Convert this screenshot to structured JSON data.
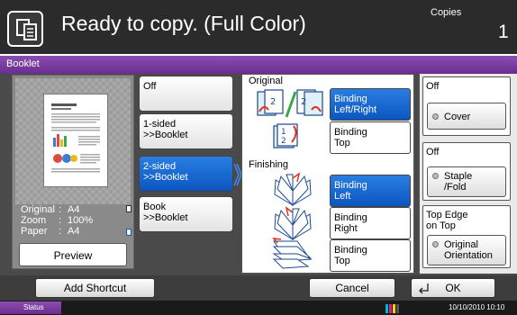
{
  "header": {
    "title": "Ready to copy. (Full Color)",
    "copies_label": "Copies",
    "copies_count": "1"
  },
  "booklet_bar": {
    "label": "Booklet"
  },
  "preview": {
    "info": [
      {
        "key": "Original",
        "value": "A4"
      },
      {
        "key": "Zoom",
        "value": "100%"
      },
      {
        "key": "Paper",
        "value": "A4"
      }
    ],
    "button_label": "Preview"
  },
  "modes": {
    "off": "Off",
    "one_sided_line1": "1-sided",
    "one_sided_line2": ">>Booklet",
    "two_sided_line1": "2-sided",
    "two_sided_line2": ">>Booklet",
    "book_line1": "Book",
    "book_line2": ">>Booklet"
  },
  "original": {
    "label": "Original",
    "binding_lr_line1": "Binding",
    "binding_lr_line2": "Left/Right",
    "binding_top_line1": "Binding",
    "binding_top_line2": "Top"
  },
  "finishing": {
    "label": "Finishing",
    "binding_left_line1": "Binding",
    "binding_left_line2": "Left",
    "binding_right_line1": "Binding",
    "binding_right_line2": "Right",
    "binding_top_line1": "Binding",
    "binding_top_line2": "Top"
  },
  "cover": {
    "value": "Off",
    "button": "Cover"
  },
  "staple": {
    "value": "Off",
    "button_line1": "Staple",
    "button_line2": "/Fold"
  },
  "orientation": {
    "value_line1": "Top Edge",
    "value_line2": "on Top",
    "button_line1": "Original",
    "button_line2": "Orientation"
  },
  "bottom": {
    "add_shortcut": "Add Shortcut",
    "cancel": "Cancel",
    "ok": "OK"
  },
  "status": {
    "label": "Status",
    "datetime": "10/10/2010  10:10"
  },
  "colors": {
    "accent_purple": "#7a3aa3",
    "selected_blue": "#1566d6",
    "header_bg": "#2b2b2b"
  }
}
